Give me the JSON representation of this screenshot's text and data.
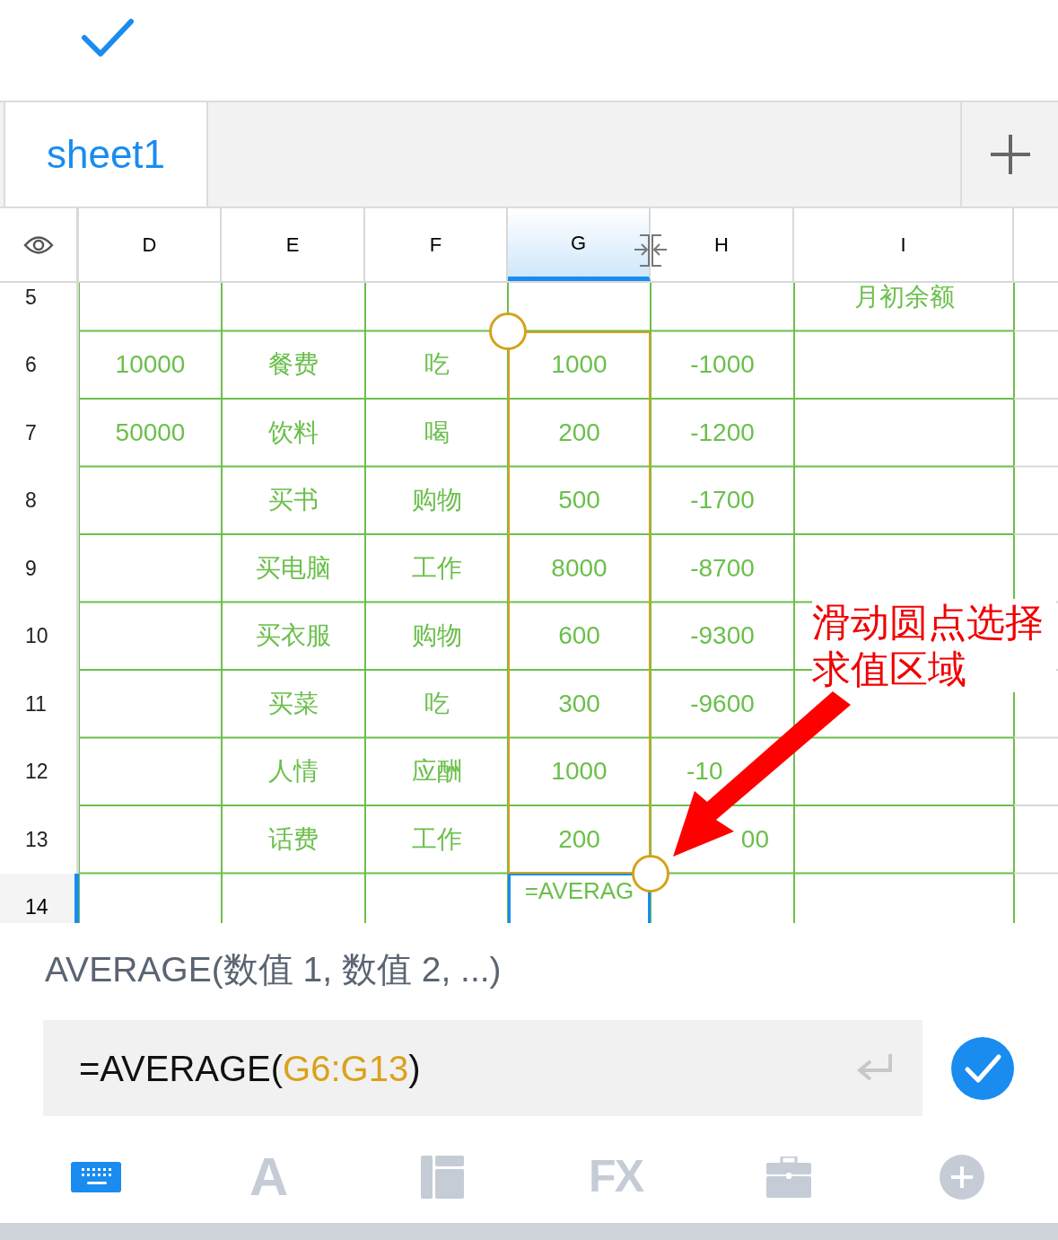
{
  "sheet_tabs": [
    {
      "label": "sheet1",
      "selected": true
    }
  ],
  "table": {
    "columns": [
      {
        "label": "D",
        "selected": false
      },
      {
        "label": "E",
        "selected": false
      },
      {
        "label": "F",
        "selected": false
      },
      {
        "label": "G",
        "selected": true
      },
      {
        "label": "H",
        "selected": false
      },
      {
        "label": "I",
        "selected": false
      }
    ],
    "rows": [
      {
        "label": "5",
        "selected": false,
        "in_range": false,
        "cells": [
          null,
          null,
          null,
          null,
          null,
          {
            "text": "月初余额",
            "kind": "whole"
          }
        ]
      },
      {
        "label": "6",
        "selected": false,
        "in_range": true,
        "cells": [
          {
            "text": "10000",
            "kind": "whole"
          },
          {
            "text": "餐费",
            "kind": "whole"
          },
          {
            "text": "吃",
            "kind": "whole"
          },
          {
            "text": "1000",
            "kind": "whole"
          },
          {
            "text": "-1000",
            "kind": "whole"
          },
          null
        ]
      },
      {
        "label": "7",
        "selected": false,
        "in_range": true,
        "cells": [
          {
            "text": "50000",
            "kind": "whole"
          },
          {
            "text": "饮料",
            "kind": "whole"
          },
          {
            "text": "喝",
            "kind": "whole"
          },
          {
            "text": "200",
            "kind": "whole"
          },
          {
            "text": "-1200",
            "kind": "whole"
          },
          null
        ]
      },
      {
        "label": "8",
        "selected": false,
        "in_range": true,
        "cells": [
          null,
          {
            "text": "买书",
            "kind": "whole"
          },
          {
            "text": "购物",
            "kind": "whole"
          },
          {
            "text": "500",
            "kind": "whole"
          },
          {
            "text": "-1700",
            "kind": "whole"
          },
          null
        ]
      },
      {
        "label": "9",
        "selected": false,
        "in_range": true,
        "cells": [
          null,
          {
            "text": "买电脑",
            "kind": "whole"
          },
          {
            "text": "工作",
            "kind": "whole"
          },
          {
            "text": "8000",
            "kind": "whole"
          },
          {
            "text": "-8700",
            "kind": "whole"
          },
          null
        ]
      },
      {
        "label": "10",
        "selected": false,
        "in_range": true,
        "cells": [
          null,
          {
            "text": "买衣服",
            "kind": "whole"
          },
          {
            "text": "购物",
            "kind": "whole"
          },
          {
            "text": "600",
            "kind": "whole"
          },
          {
            "text": "-9300",
            "kind": "whole"
          },
          null
        ]
      },
      {
        "label": "11",
        "selected": false,
        "in_range": true,
        "cells": [
          null,
          {
            "text": "买菜",
            "kind": "whole"
          },
          {
            "text": "吃",
            "kind": "whole"
          },
          {
            "text": "300",
            "kind": "whole"
          },
          {
            "text": "-9600",
            "kind": "whole"
          },
          null
        ]
      },
      {
        "label": "12",
        "selected": false,
        "in_range": true,
        "cells": [
          null,
          {
            "text": "人情",
            "kind": "whole"
          },
          {
            "text": "应酬",
            "kind": "whole"
          },
          {
            "text": "1000",
            "kind": "whole"
          },
          {
            "text": "-10",
            "kind": "cut_end"
          },
          null
        ]
      },
      {
        "label": "13",
        "selected": false,
        "in_range": true,
        "cells": [
          null,
          {
            "text": "话费",
            "kind": "whole"
          },
          {
            "text": "工作",
            "kind": "whole"
          },
          {
            "text": "200",
            "kind": "whole"
          },
          {
            "text": "00",
            "kind": "cut_start"
          },
          null
        ]
      },
      {
        "label": "14",
        "selected": true,
        "in_range": false,
        "cells": [
          null,
          null,
          null,
          {
            "text": "=AVERAG",
            "kind": "whole"
          },
          null,
          null
        ]
      }
    ]
  },
  "annotation": {
    "text": "滑动圆点选择求值区域"
  },
  "function_hint": "AVERAGE(数值 1, 数值 2, ...)",
  "formula": {
    "parts": [
      {
        "kind": "plain",
        "text": "=AVERAGE("
      },
      {
        "kind": "range",
        "text": "G6:G13"
      },
      {
        "kind": "plain",
        "text": ")"
      }
    ]
  },
  "bottom_tabs": [
    {
      "kind": "keyboard",
      "selected": true
    },
    {
      "kind": "font",
      "glyph": "A",
      "selected": false
    },
    {
      "kind": "layout",
      "selected": false
    },
    {
      "kind": "function",
      "glyph": "FX",
      "selected": false
    },
    {
      "kind": "tools",
      "selected": false
    },
    {
      "kind": "insert",
      "selected": false
    }
  ]
}
